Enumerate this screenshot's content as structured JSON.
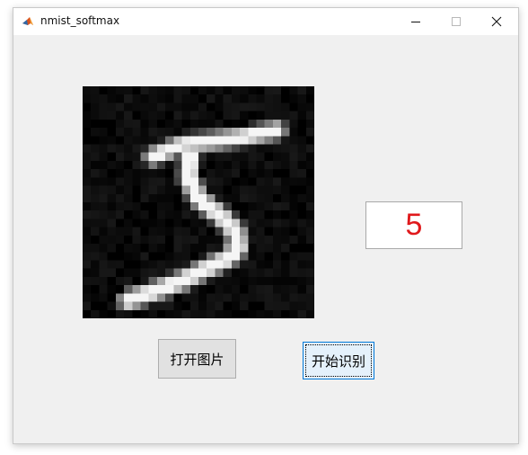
{
  "window": {
    "title": "nmist_softmax",
    "controls": [
      "minimize-icon",
      "maximize-icon",
      "close-icon"
    ]
  },
  "image_panel": {
    "content": "handwritten digit image"
  },
  "result": {
    "value": "5",
    "color": "#e0191c"
  },
  "buttons": {
    "open_image": "打开图片",
    "start_recognition": "开始识别"
  },
  "colors": {
    "background": "#f0f0f0",
    "button_face": "#e1e1e1",
    "focus_border": "#0078d7"
  }
}
